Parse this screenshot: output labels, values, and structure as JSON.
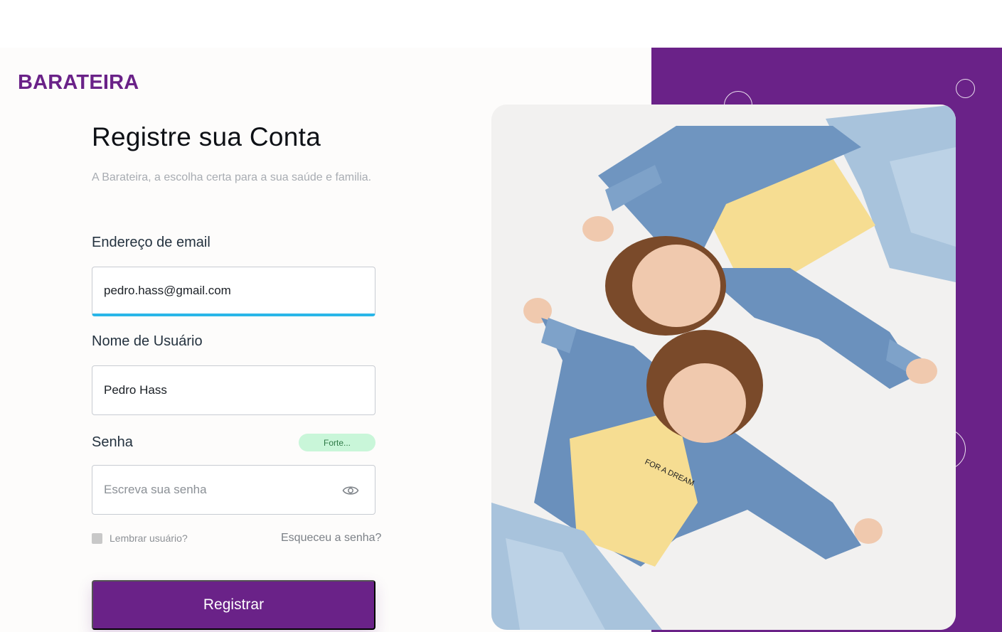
{
  "brand": {
    "name": "BARATEIRA"
  },
  "header": {
    "title": "Registre sua Conta",
    "subtitle": "A Barateira, a escolha certa para a sua saúde e familia."
  },
  "form": {
    "email": {
      "label": "Endereço de email",
      "value": "pedro.hass@gmail.com"
    },
    "username": {
      "label": "Nome de Usuário",
      "value": "Pedro Hass"
    },
    "password": {
      "label": "Senha",
      "placeholder": "Escreva sua senha",
      "strength": "Forte..."
    },
    "remember_label": "Lembrar usuário?",
    "forgot_label": "Esqueceu a senha?",
    "submit_label": "Registrar"
  },
  "colors": {
    "brand": "#6a2288",
    "focus": "#29b6e8",
    "strength_bg": "#c9f6d9"
  },
  "photo": {
    "shirt_text": "FOR A DREAM"
  }
}
